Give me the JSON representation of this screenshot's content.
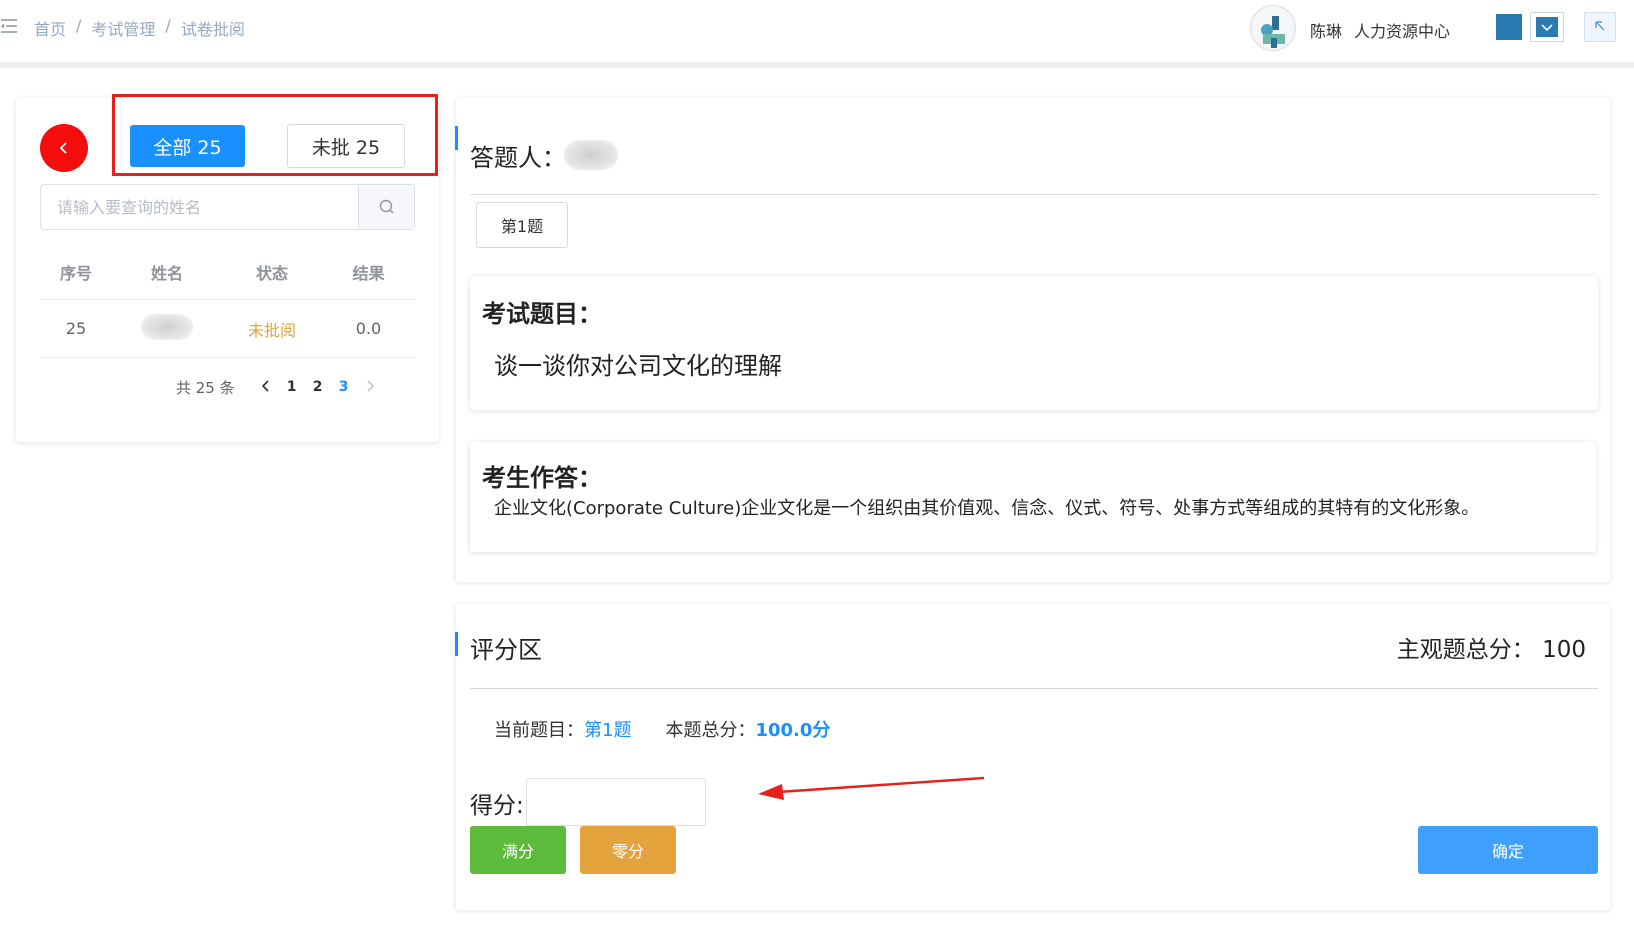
{
  "breadcrumb": [
    "首页",
    "考试管理",
    "试卷批阅"
  ],
  "user": {
    "name": "陈琳",
    "department": "人力资源中心"
  },
  "filters": {
    "all_label": "全部 25",
    "unreviewed_label": "未批 25"
  },
  "search": {
    "placeholder": "请输入要查询的姓名"
  },
  "table": {
    "headers": [
      "序号",
      "姓名",
      "状态",
      "结果"
    ],
    "rows": [
      {
        "index": "25",
        "status": "未批阅",
        "result": "0.0"
      }
    ]
  },
  "pagination": {
    "total_label": "共 25 条",
    "pages": [
      "1",
      "2",
      "3"
    ],
    "current": "3"
  },
  "answer_panel": {
    "answerer_label": "答题人：",
    "question_tab": "第1题",
    "question_title": "考试题目：",
    "question_text": "谈一谈你对公司文化的理解",
    "answer_title": "考生作答：",
    "answer_text": "企业文化(Corporate Culture)企业文化是一个组织由其价值观、信念、仪式、符号、处事方式等组成的其特有的文化形象。"
  },
  "scoring": {
    "title": "评分区",
    "total_label": "主观题总分：",
    "total_value": "100",
    "current_q_label": "当前题目：",
    "current_q_value": "第1题",
    "q_total_label": "本题总分：",
    "q_total_value": "100.0分",
    "score_label": "得分:",
    "score_value": "",
    "full_label": "满分",
    "zero_label": "零分",
    "confirm_label": "确定"
  },
  "colors": {
    "primary": "#1890ff",
    "danger": "#f30d0d",
    "success": "#5cbb3a",
    "warning": "#e4a33c",
    "pending": "#e6a23c"
  }
}
